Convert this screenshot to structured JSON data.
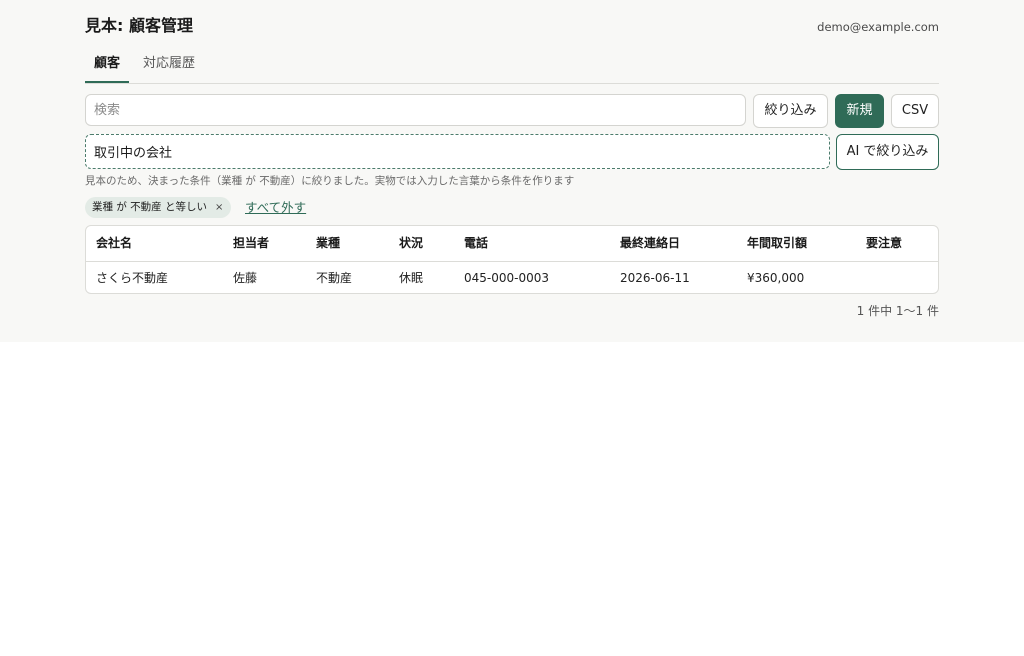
{
  "header": {
    "title": "見本: 顧客管理",
    "user_email": "demo@example.com"
  },
  "tabs": [
    {
      "label": "顧客",
      "active": true
    },
    {
      "label": "対応履歴",
      "active": false
    }
  ],
  "search": {
    "placeholder": "検索",
    "value": ""
  },
  "toolbar": {
    "filter_label": "絞り込み",
    "new_label": "新規",
    "csv_label": "CSV"
  },
  "ai_filter": {
    "value": "取引中の会社",
    "button_label": "AI で絞り込み",
    "hint": "見本のため、決まった条件（業種 が 不動産）に絞りました。実物では入力した言葉から条件を作ります"
  },
  "filter_chips": [
    {
      "label": "業種 が 不動産 と等しい",
      "close": "×"
    }
  ],
  "clear_all_label": "すべて外す",
  "table": {
    "columns": [
      "会社名",
      "担当者",
      "業種",
      "状況",
      "電話",
      "最終連絡日",
      "年間取引額",
      "要注意"
    ],
    "rows": [
      [
        "さくら不動産",
        "佐藤",
        "不動産",
        "休眠",
        "045-000-0003",
        "2026-06-11",
        "¥360,000",
        ""
      ]
    ]
  },
  "pagination": {
    "text": "1 件中 1〜1 件"
  },
  "colors": {
    "accent": "#2f6b57",
    "background": "#f8f8f6",
    "chip_background": "#e3ebe6"
  }
}
